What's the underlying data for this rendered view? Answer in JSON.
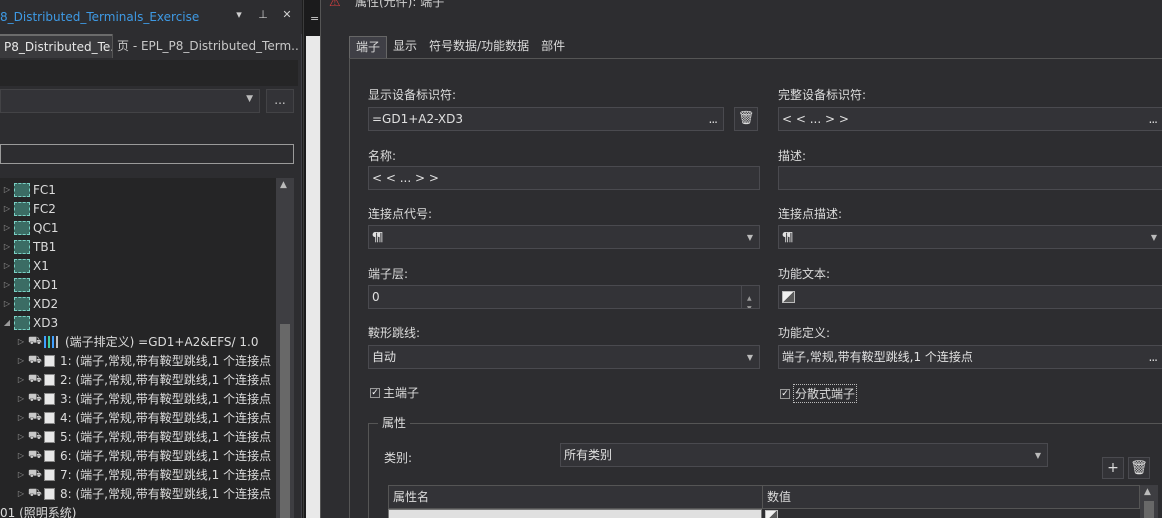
{
  "left_panel": {
    "title": "8_Distributed_Terminals_Exercise",
    "title_buttons": [
      "▾",
      "⊥",
      "✕"
    ],
    "tabs": [
      {
        "label": "P8_Distributed_Te..."
      },
      {
        "label": "页 - EPL_P8_Distributed_Term..."
      }
    ],
    "combo_more": "...",
    "tree": [
      {
        "label": "FC1",
        "kind": "device"
      },
      {
        "label": "FC2",
        "kind": "device"
      },
      {
        "label": "QC1",
        "kind": "device"
      },
      {
        "label": "TB1",
        "kind": "device"
      },
      {
        "label": "X1",
        "kind": "device"
      },
      {
        "label": "XD1",
        "kind": "device"
      },
      {
        "label": "XD2",
        "kind": "device"
      },
      {
        "label": "XD3",
        "kind": "device"
      },
      {
        "label": "(端子排定义) =GD1+A2&EFS/ 1.0",
        "kind": "strip-def"
      },
      {
        "label": "1: (端子,常规,带有鞍型跳线,1 个连接点",
        "kind": "terminal"
      },
      {
        "label": "2: (端子,常规,带有鞍型跳线,1 个连接点",
        "kind": "terminal"
      },
      {
        "label": "3: (端子,常规,带有鞍型跳线,1 个连接点",
        "kind": "terminal"
      },
      {
        "label": "4: (端子,常规,带有鞍型跳线,1 个连接点",
        "kind": "terminal"
      },
      {
        "label": "5: (端子,常规,带有鞍型跳线,1 个连接点",
        "kind": "terminal"
      },
      {
        "label": "6: (端子,常规,带有鞍型跳线,1 个连接点",
        "kind": "terminal"
      },
      {
        "label": "7: (端子,常规,带有鞍型跳线,1 个连接点",
        "kind": "terminal"
      },
      {
        "label": "8: (端子,常规,带有鞍型跳线,1 个连接点",
        "kind": "terminal"
      },
      {
        "label": "01 (照明系统)",
        "kind": "group"
      }
    ]
  },
  "middle": {
    "top_glyph": "="
  },
  "dialog": {
    "title": "属性(元件): 端子",
    "tabs": [
      "端子",
      "显示",
      "符号数据/功能数据",
      "部件"
    ],
    "fields": {
      "display_id_label": "显示设备标识符:",
      "display_id_value": "=GD1+A2-XD3",
      "full_id_label": "完整设备标识符:",
      "full_id_value": "< < ... > >",
      "name_label": "名称:",
      "name_value": "< < ... > >",
      "desc_label": "描述:",
      "desc_value": "",
      "conn_code_label": "连接点代号:",
      "conn_code_value": "¶¶",
      "conn_desc_label": "连接点描述:",
      "conn_desc_value": "¶¶",
      "layer_label": "端子层:",
      "layer_value": "0",
      "func_text_label": "功能文本:",
      "jumper_label": "鞍形跳线:",
      "jumper_value": "自动",
      "func_def_label": "功能定义:",
      "func_def_value": "端子,常规,带有鞍型跳线,1 个连接点",
      "dots": "..."
    },
    "checkboxes": {
      "main_terminal": {
        "label": "主端子",
        "checked": true
      },
      "distributed_terminal": {
        "label": "分散式端子",
        "checked": true
      }
    },
    "properties": {
      "legend": "属性",
      "category_label": "类别:",
      "category_value": "所有类别",
      "add_glyph": "+",
      "delete_glyph": "🗑",
      "columns": [
        "属性名",
        "数值"
      ]
    }
  },
  "colors": {
    "background": "#2d2d30",
    "accent_title": "#3e9ae5",
    "field_bg": "#333337",
    "device_icon": "#3b6c64"
  }
}
